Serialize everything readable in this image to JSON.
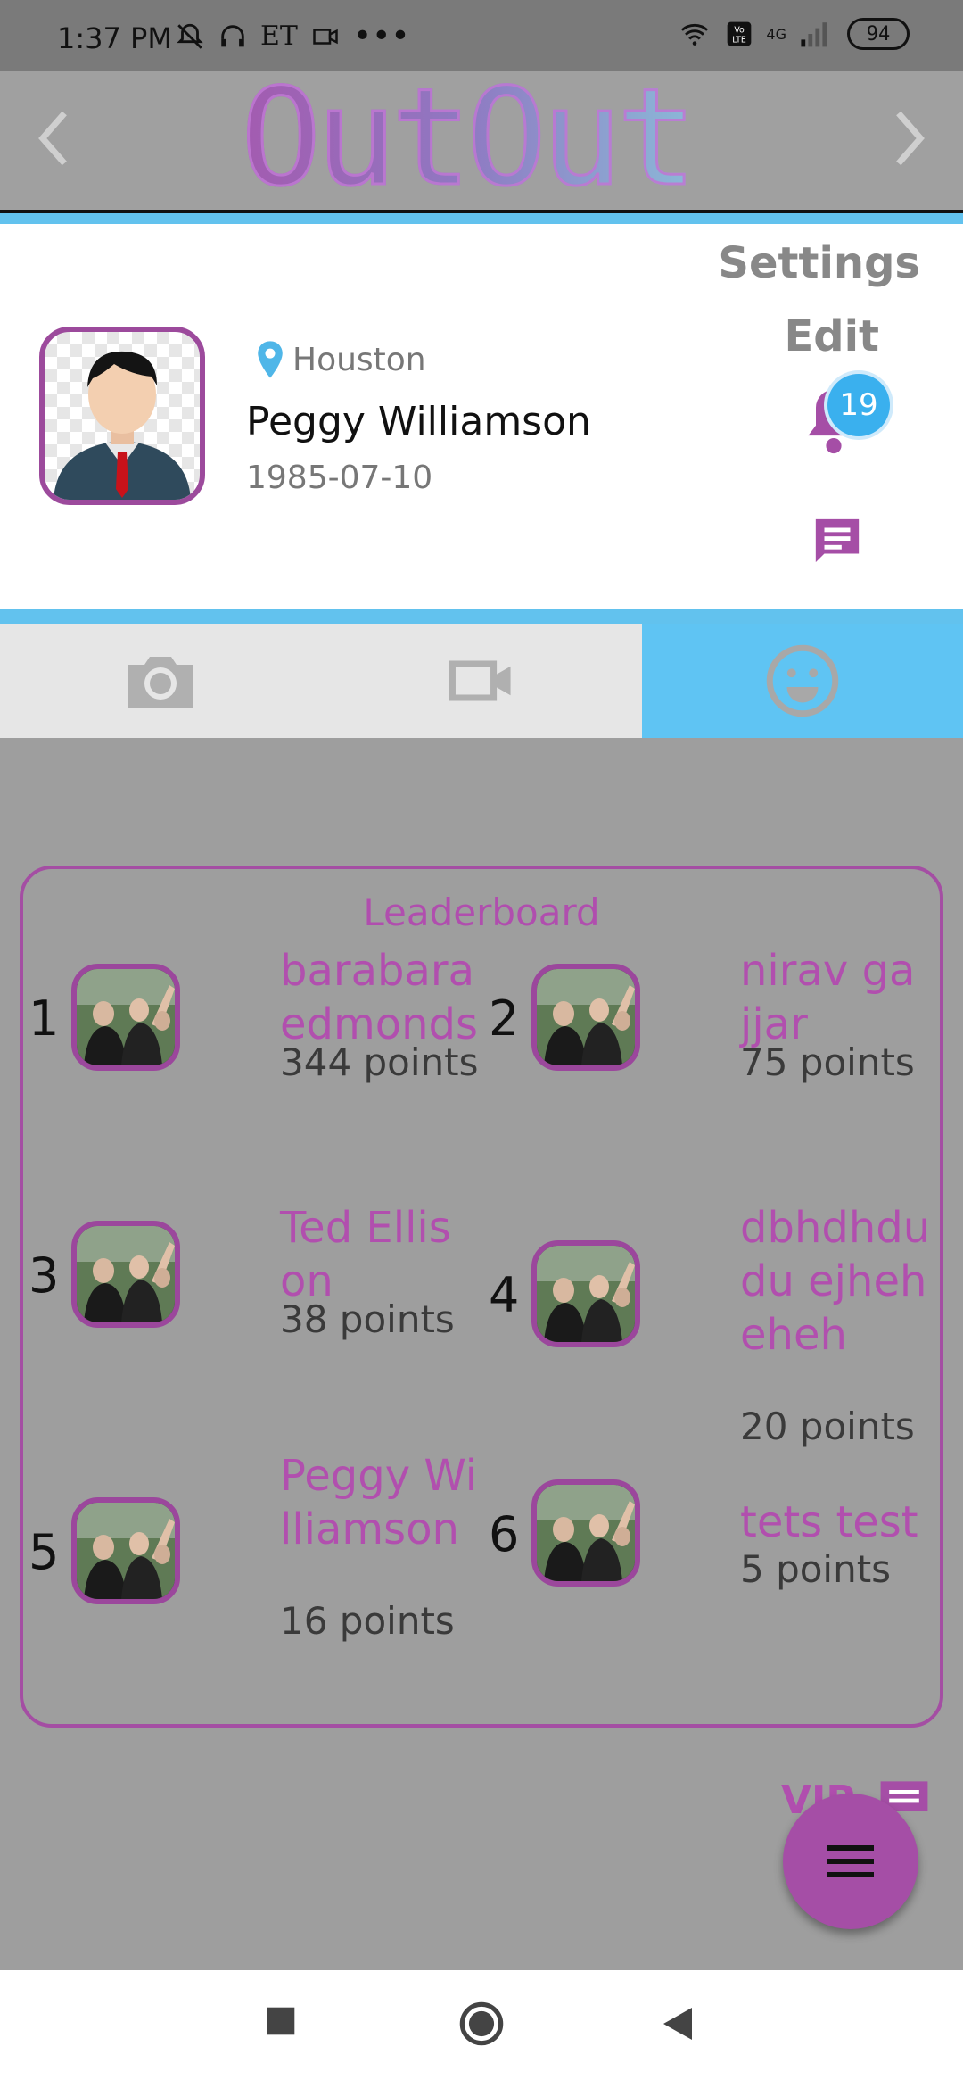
{
  "status_bar": {
    "time": "1:37 PM",
    "carrier_badge": "ET",
    "network": "4G",
    "battery": "94"
  },
  "app_bar": {
    "logo_text": "OutOut"
  },
  "profile": {
    "location": "Houston",
    "name": "Peggy Williamson",
    "birthdate": "1985-07-10",
    "settings_label": "Settings",
    "edit_label": "Edit",
    "notification_count": "19"
  },
  "tabs": [
    {
      "icon": "camera-icon",
      "active": false
    },
    {
      "icon": "video-icon",
      "active": false
    },
    {
      "icon": "smiley-icon",
      "active": true
    }
  ],
  "leaderboard": {
    "title": "Leaderboard",
    "entries": [
      {
        "rank": "1",
        "name": "barabara edmonds",
        "points": "344 points"
      },
      {
        "rank": "2",
        "name": "nirav gajjar",
        "points": "75 points"
      },
      {
        "rank": "3",
        "name": "Ted Ellison",
        "points": "38 points"
      },
      {
        "rank": "4",
        "name": "dbhdhdudu ejheheheh",
        "points": "20 points"
      },
      {
        "rank": "5",
        "name": "Peggy Williamson",
        "points": "16 points"
      },
      {
        "rank": "6",
        "name": "tets test",
        "points": "5 points"
      }
    ]
  },
  "vip_label": "VIP",
  "colors": {
    "accent_purple": "#a54ea6",
    "accent_blue": "#5fc4f3",
    "overlay_gray": "#9e9e9e"
  }
}
